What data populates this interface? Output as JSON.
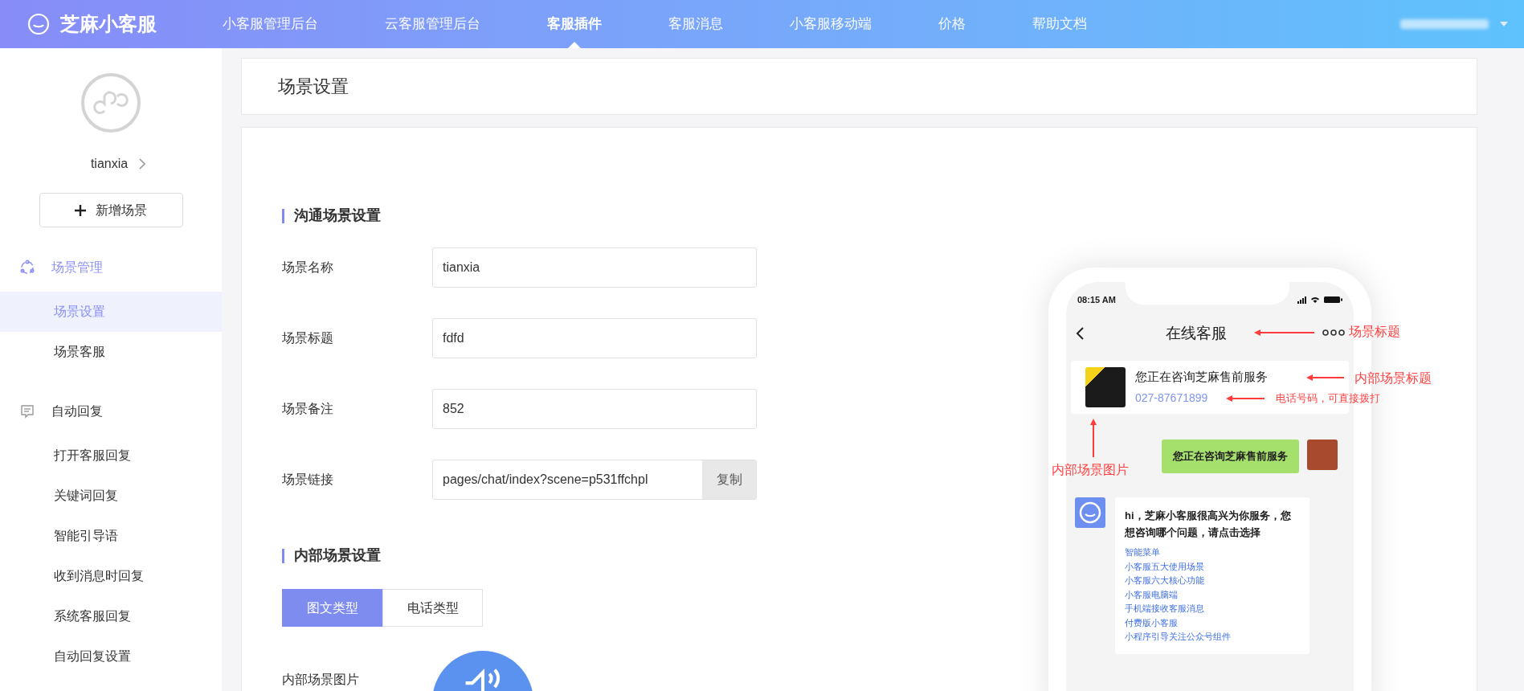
{
  "brand": "芝麻小客服",
  "nav": [
    {
      "label": "小客服管理后台",
      "selected": false
    },
    {
      "label": "云客服管理后台",
      "selected": false
    },
    {
      "label": "客服插件",
      "selected": true
    },
    {
      "label": "客服消息",
      "selected": false
    },
    {
      "label": "小客服移动端",
      "selected": false
    },
    {
      "label": "价格",
      "selected": false
    },
    {
      "label": "帮助文档",
      "selected": false
    }
  ],
  "sidebar": {
    "profile_name": "tianxia",
    "add_button": "新增场景",
    "groups": [
      {
        "title": "场景管理",
        "kind": "scene",
        "selected": true,
        "items": [
          {
            "label": "场景设置",
            "selected": true
          },
          {
            "label": "场景客服",
            "selected": false
          }
        ]
      },
      {
        "title": "自动回复",
        "kind": "message",
        "selected": false,
        "items": [
          {
            "label": "打开客服回复",
            "selected": false
          },
          {
            "label": "关键词回复",
            "selected": false
          },
          {
            "label": "智能引导语",
            "selected": false
          },
          {
            "label": "收到消息时回复",
            "selected": false
          },
          {
            "label": "系统客服回复",
            "selected": false
          },
          {
            "label": "自动回复设置",
            "selected": false
          }
        ]
      }
    ]
  },
  "page_title": "场景设置",
  "scene_section": {
    "title": "沟通场景设置",
    "fields": [
      {
        "label": "场景名称",
        "value": "tianxia",
        "kind": "text"
      },
      {
        "label": "场景标题",
        "value": "fdfd",
        "kind": "text"
      },
      {
        "label": "场景备注",
        "value": "852",
        "kind": "text"
      },
      {
        "label": "场景链接",
        "value": "pages/chat/index?scene=p531ffchpl",
        "kind": "copy",
        "button": "复制"
      }
    ]
  },
  "inner_section": {
    "title": "内部场景设置",
    "tabs": [
      {
        "label": "图文类型",
        "selected": true
      },
      {
        "label": "电话类型",
        "selected": false
      }
    ],
    "image_label": "内部场景图片"
  },
  "preview": {
    "time": "08:15 AM",
    "title": "在线客服",
    "card_title": "您正在咨询芝麻售前服务",
    "card_phone": "027-87671899",
    "user_message": "您正在咨询芝麻售前服务",
    "bot_message": "hi，芝麻小客服很高兴为你服务，您想咨询哪个问题，请点击选择",
    "bot_links": [
      "智能菜单",
      "小客服五大使用场景",
      "小客服六大核心功能",
      "小客服电脑端",
      "手机端接收客服消息",
      "付费版小客服",
      "小程序引导关注公众号组件"
    ],
    "annotations": [
      {
        "kind": "title",
        "text": "场景标题"
      },
      {
        "kind": "card_title",
        "text": "内部场景标题"
      },
      {
        "kind": "phone",
        "text": "电话号码，可直接拨打"
      },
      {
        "kind": "image",
        "text": "内部场景图片"
      }
    ]
  }
}
